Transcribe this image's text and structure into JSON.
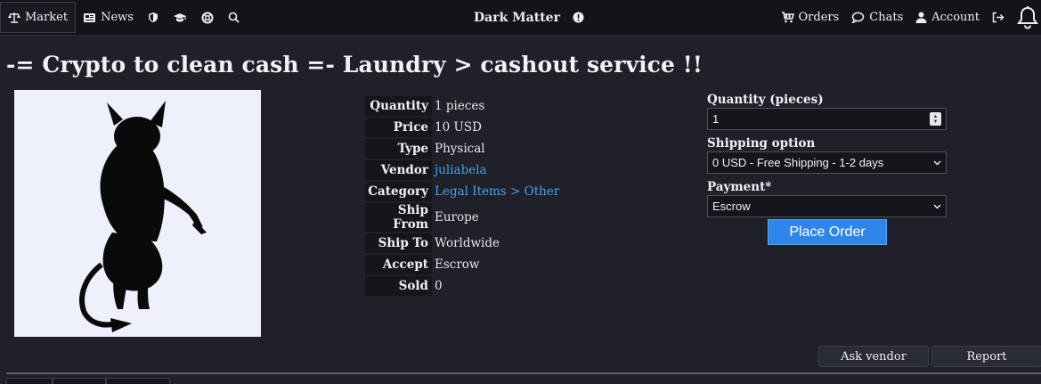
{
  "nav": {
    "market": "Market",
    "news": "News",
    "icons": [
      "shield-icon",
      "graduation-cap-icon",
      "lifebuoy-icon",
      "search-icon"
    ]
  },
  "brand": {
    "title": "Dark Matter",
    "info_icon": "info-icon"
  },
  "account_nav": {
    "orders": "Orders",
    "chats": "Chats",
    "account": "Account"
  },
  "listing": {
    "title": "-= Crypto to clean cash =- Laundry > cashout service !!",
    "image_icon": "devil-silhouette-image",
    "details": [
      {
        "key": "Quantity",
        "value": "1 pieces"
      },
      {
        "key": "Price",
        "value": "10 USD"
      },
      {
        "key": "Type",
        "value": "Physical"
      },
      {
        "key": "Vendor",
        "value": "juliabela",
        "link": true
      },
      {
        "key": "Category",
        "value": "Legal Items > Other",
        "link": true
      },
      {
        "key": "Ship From",
        "value": "Europe"
      },
      {
        "key": "Ship To",
        "value": "Worldwide"
      },
      {
        "key": "Accept",
        "value": "Escrow"
      },
      {
        "key": "Sold",
        "value": "0"
      }
    ]
  },
  "order_form": {
    "quantity_label": "Quantity (pieces)",
    "quantity_value": "1",
    "shipping_label": "Shipping option",
    "shipping_value": "0 USD - Free Shipping - 1-2 days",
    "payment_label": "Payment*",
    "payment_value": "Escrow",
    "place_order": "Place Order"
  },
  "actions": {
    "ask_vendor": "Ask vendor",
    "report": "Report"
  },
  "colors": {
    "accent": "#2f86ea",
    "link": "#4a9fe8",
    "background": "#1f2029",
    "topbar": "#13141a"
  }
}
